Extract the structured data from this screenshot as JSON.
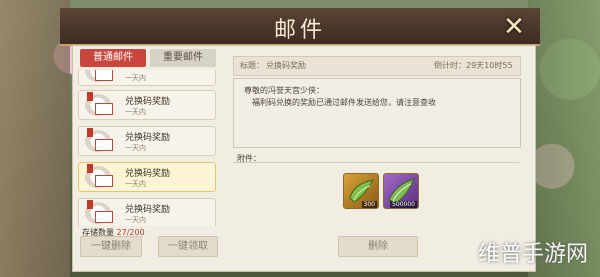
{
  "window": {
    "title": "邮件",
    "close_label": "✕"
  },
  "tabs": [
    {
      "label": "普通邮件"
    },
    {
      "label": "重要邮件"
    }
  ],
  "mail_list": [
    {
      "title": "",
      "time": "一天内"
    },
    {
      "title": "兑换码奖励",
      "time": "一天内"
    },
    {
      "title": "兑换码奖励",
      "time": "一天内"
    },
    {
      "title": "兑换码奖励",
      "time": "一天内"
    },
    {
      "title": "兑换码奖励",
      "time": "一天内"
    }
  ],
  "storage": {
    "label": "存储数量",
    "count": "27/200"
  },
  "buttons": {
    "delete_all": "一键删除",
    "claim_all": "一键领取",
    "delete": "删除"
  },
  "detail": {
    "subject_label": "标题：",
    "subject": "兑换码奖励",
    "countdown_label": "倒计时：",
    "countdown": "29天10时55分",
    "greeting": "尊敬的冯誉天宫少侠：",
    "body": "福利码兑换的奖励已通过邮件发送给您，请注意查收",
    "attachments_label": "附件：",
    "attachments": [
      {
        "icon": "green-wing-icon",
        "quantity": "300"
      },
      {
        "icon": "purple-wing-icon",
        "quantity": "500000"
      }
    ]
  },
  "watermark": "维普手游网",
  "colors": {
    "tab_active": "#c9463c",
    "header": "#4a382c",
    "panel": "#f1ede3"
  }
}
